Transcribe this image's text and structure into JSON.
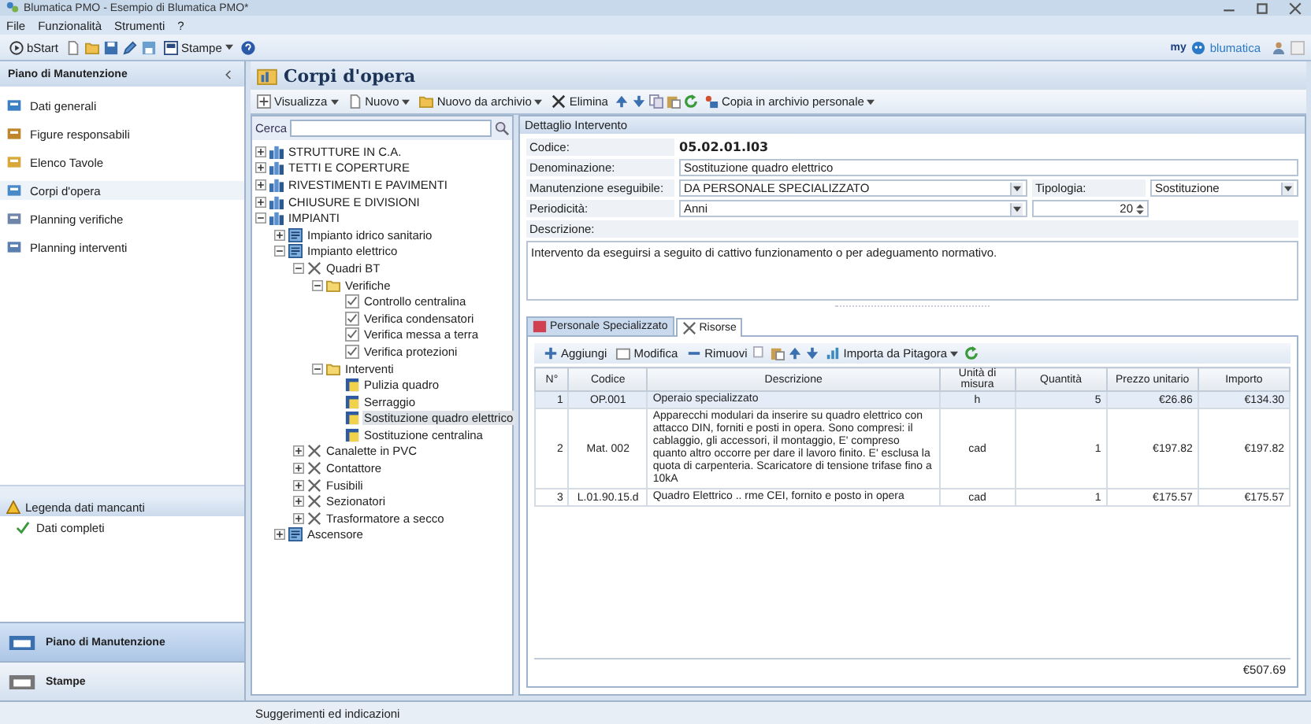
{
  "window": {
    "title": "Blumatica PMO - Esempio di Blumatica PMO*"
  },
  "menu": [
    "File",
    "Funzionalità",
    "Strumenti",
    "?"
  ],
  "toolbar": {
    "start": "bStart",
    "print": "Stampe",
    "logo_prefix": "my",
    "logo": "blumatica"
  },
  "sidebar": {
    "title": "Piano di Manutenzione",
    "items": [
      {
        "label": "Dati generali",
        "selected": false
      },
      {
        "label": "Figure responsabili",
        "selected": false
      },
      {
        "label": "Elenco Tavole",
        "selected": false
      },
      {
        "label": "Corpi d'opera",
        "selected": true
      },
      {
        "label": "Planning verifiche",
        "selected": false
      },
      {
        "label": "Planning interventi",
        "selected": false
      }
    ],
    "legend_title": "Legenda dati mancanti",
    "legend": [
      "Dati completi"
    ],
    "sections": [
      {
        "label": "Piano di Manutenzione",
        "selected": true
      },
      {
        "label": "Stampe",
        "selected": false
      }
    ]
  },
  "page": {
    "title": "Corpi d'opera",
    "actions": [
      {
        "label": "Visualizza",
        "has_menu": true
      },
      {
        "label": "Nuovo",
        "has_menu": true
      },
      {
        "label": "Nuovo da archivio",
        "has_menu": true
      },
      {
        "label": "Elimina",
        "has_menu": false
      },
      {
        "label": "Copia in archivio personale",
        "has_menu": true
      }
    ]
  },
  "tree": {
    "search_label": "Cerca",
    "items": [
      {
        "label": "STRUTTURE IN C.A.",
        "kind": "group",
        "expanded": false,
        "selected": false
      },
      {
        "label": "TETTI E COPERTURE",
        "kind": "group",
        "expanded": false,
        "selected": false
      },
      {
        "label": "RIVESTIMENTI E PAVIMENTI",
        "kind": "group",
        "expanded": false,
        "selected": false
      },
      {
        "label": "CHIUSURE E DIVISIONI",
        "kind": "group",
        "expanded": false,
        "selected": false
      },
      {
        "label": "IMPIANTI",
        "kind": "group",
        "expanded": true,
        "selected": false,
        "children": [
          {
            "label": "Impianto idrico sanitario",
            "kind": "system",
            "expanded": false,
            "selected": false
          },
          {
            "label": "Impianto elettrico",
            "kind": "system",
            "expanded": true,
            "selected": false,
            "children": [
              {
                "label": "Quadri BT",
                "kind": "tool",
                "expanded": true,
                "selected": false,
                "children": [
                  {
                    "label": "Verifiche",
                    "kind": "folder",
                    "expanded": true,
                    "selected": false,
                    "children": [
                      {
                        "label": "Controllo centralina",
                        "kind": "check",
                        "selected": false
                      },
                      {
                        "label": "Verifica condensatori",
                        "kind": "check",
                        "selected": false
                      },
                      {
                        "label": "Verifica messa a terra",
                        "kind": "check",
                        "selected": false
                      },
                      {
                        "label": "Verifica protezioni",
                        "kind": "check",
                        "selected": false
                      }
                    ]
                  },
                  {
                    "label": "Interventi",
                    "kind": "folder",
                    "expanded": true,
                    "selected": false,
                    "children": [
                      {
                        "label": "Pulizia quadro",
                        "kind": "task",
                        "selected": false
                      },
                      {
                        "label": "Serraggio",
                        "kind": "task",
                        "selected": false
                      },
                      {
                        "label": "Sostituzione quadro elettrico",
                        "kind": "task",
                        "selected": true
                      },
                      {
                        "label": "Sostituzione centralina",
                        "kind": "task",
                        "selected": false
                      }
                    ]
                  }
                ]
              },
              {
                "label": "Canalette in PVC",
                "kind": "tool",
                "expanded": false,
                "selected": false
              },
              {
                "label": "Contattore",
                "kind": "tool",
                "expanded": false,
                "selected": false
              },
              {
                "label": "Fusibili",
                "kind": "tool",
                "expanded": false,
                "selected": false
              },
              {
                "label": "Sezionatori",
                "kind": "tool",
                "expanded": false,
                "selected": false
              },
              {
                "label": "Trasformatore a secco",
                "kind": "tool",
                "expanded": false,
                "selected": false
              }
            ]
          },
          {
            "label": "Ascensore",
            "kind": "system",
            "expanded": false,
            "selected": false
          }
        ]
      }
    ]
  },
  "detail": {
    "title": "Dettaglio Intervento",
    "code_label": "Codice:",
    "code": "05.02.01.I03",
    "name_label": "Denominazione:",
    "name": "Sostituzione quadro elettrico",
    "mode_label": "Manutenzione eseguibile:",
    "mode": "DA PERSONALE SPECIALIZZATO",
    "type_label": "Tipologia:",
    "type": "Sostituzione",
    "period_label": "Periodicità:",
    "period": "Anni",
    "period_count": "20",
    "description_label": "Descrizione:",
    "description": "Intervento da eseguirsi a seguito di cattivo funzionamento o per adeguamento normativo."
  },
  "tabs": [
    {
      "label": "Personale Specializzato",
      "selected": false
    },
    {
      "label": "Risorse",
      "selected": true
    }
  ],
  "grid_actions": [
    "Aggiungi",
    "Modifica",
    "Rimuovi",
    "Importa da Pitagora"
  ],
  "table": {
    "columns": [
      "N°",
      "Codice",
      "Descrizione",
      "Unità di misura",
      "Quantità",
      "Prezzo unitario",
      "Importo"
    ],
    "rows": [
      {
        "cells": [
          "1",
          "OP.001",
          "Operaio specializzato",
          "h",
          "5",
          "€26.86",
          "€134.30"
        ],
        "selected": true
      },
      {
        "cells": [
          "2",
          "Mat. 002",
          "Apparecchi modulari da inserire su quadro elettrico con attacco DIN, forniti e posti in opera. Sono compresi: il cablaggio, gli accessori, il montaggio, E' compreso quanto altro occorre per dare il lavoro finito. E' esclusa la quota di carpenteria. Scaricatore di tensione trifase fino a 10kA",
          "cad",
          "1",
          "€197.82",
          "€197.82"
        ],
        "selected": false
      },
      {
        "cells": [
          "3",
          "L.01.90.15.d",
          "Quadro Elettrico .. rme CEI, fornito e posto in opera",
          "cad",
          "1",
          "€175.57",
          "€175.57"
        ],
        "selected": false
      }
    ],
    "total": "€507.69"
  },
  "status_bar": "Suggerimenti ed indicazioni"
}
